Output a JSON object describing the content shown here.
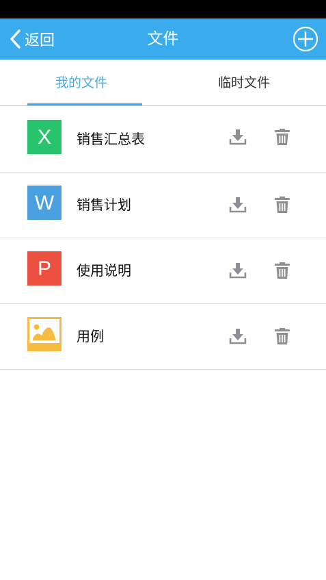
{
  "nav": {
    "back_label": "返回",
    "title": "文件",
    "back_icon": "chevron-left-icon",
    "add_icon": "plus-circle-icon"
  },
  "tabs": [
    {
      "label": "我的文件",
      "active": true
    },
    {
      "label": "临时文件",
      "active": false
    }
  ],
  "files": [
    {
      "name": "销售汇总表",
      "type": "excel",
      "icon_letter": "X",
      "icon_color": "#27c36d"
    },
    {
      "name": "销售计划",
      "type": "word",
      "icon_letter": "W",
      "icon_color": "#4a9fdf"
    },
    {
      "name": "使用说明",
      "type": "powerpoint",
      "icon_letter": "P",
      "icon_color": "#ec5040"
    },
    {
      "name": "用例",
      "type": "image",
      "icon_letter": "",
      "icon_color": "#f7bb42"
    }
  ],
  "actions": {
    "download_icon": "download-icon",
    "delete_icon": "trash-icon"
  },
  "colors": {
    "accent": "#3aabed",
    "active_tab_text": "#4aaee3",
    "action_icon": "#8e8e93"
  }
}
